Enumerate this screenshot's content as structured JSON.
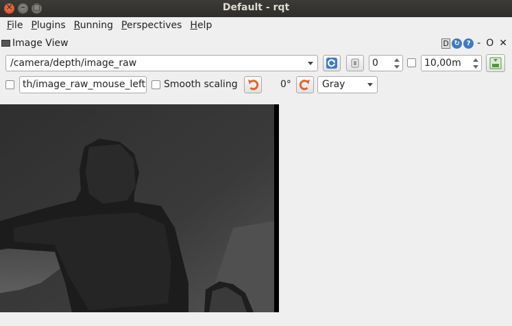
{
  "window": {
    "title": "Default - rqt"
  },
  "menu": {
    "file": {
      "label": "File",
      "u": "F",
      "rest": "ile"
    },
    "plugins": {
      "label": "Plugins",
      "u": "P",
      "rest": "lugins"
    },
    "running": {
      "label": "Running",
      "u": "R",
      "rest": "unning"
    },
    "perspectives": {
      "label": "Perspectives",
      "u": "P",
      "rest": "erspectives"
    },
    "help": {
      "label": "Help",
      "u": "H",
      "rest": "elp"
    }
  },
  "plugin": {
    "title": "Image View",
    "ctrl_d": "D",
    "ctrl_dash": "-",
    "ctrl_o": "O",
    "ctrl_x": "✕"
  },
  "toolbar": {
    "topic": "/camera/depth/image_raw",
    "spin_value": "0",
    "max_range": "10,00m",
    "mouse_topic": "th/image_raw_mouse_left",
    "smooth_scaling_label": "Smooth scaling",
    "rotation": "0°",
    "colormap": "Gray"
  },
  "colors": {
    "titlebar": "#3c3b37",
    "accent_blue": "#3d7bc4",
    "rotate_orange": "#e0642b",
    "save_green": "#4b9a3c"
  },
  "icons": [
    "close-icon",
    "minimize-icon",
    "maximize-icon",
    "refresh-icon",
    "pause-icon",
    "save-icon",
    "rotate-left-icon",
    "rotate-right-icon",
    "help-icon"
  ]
}
